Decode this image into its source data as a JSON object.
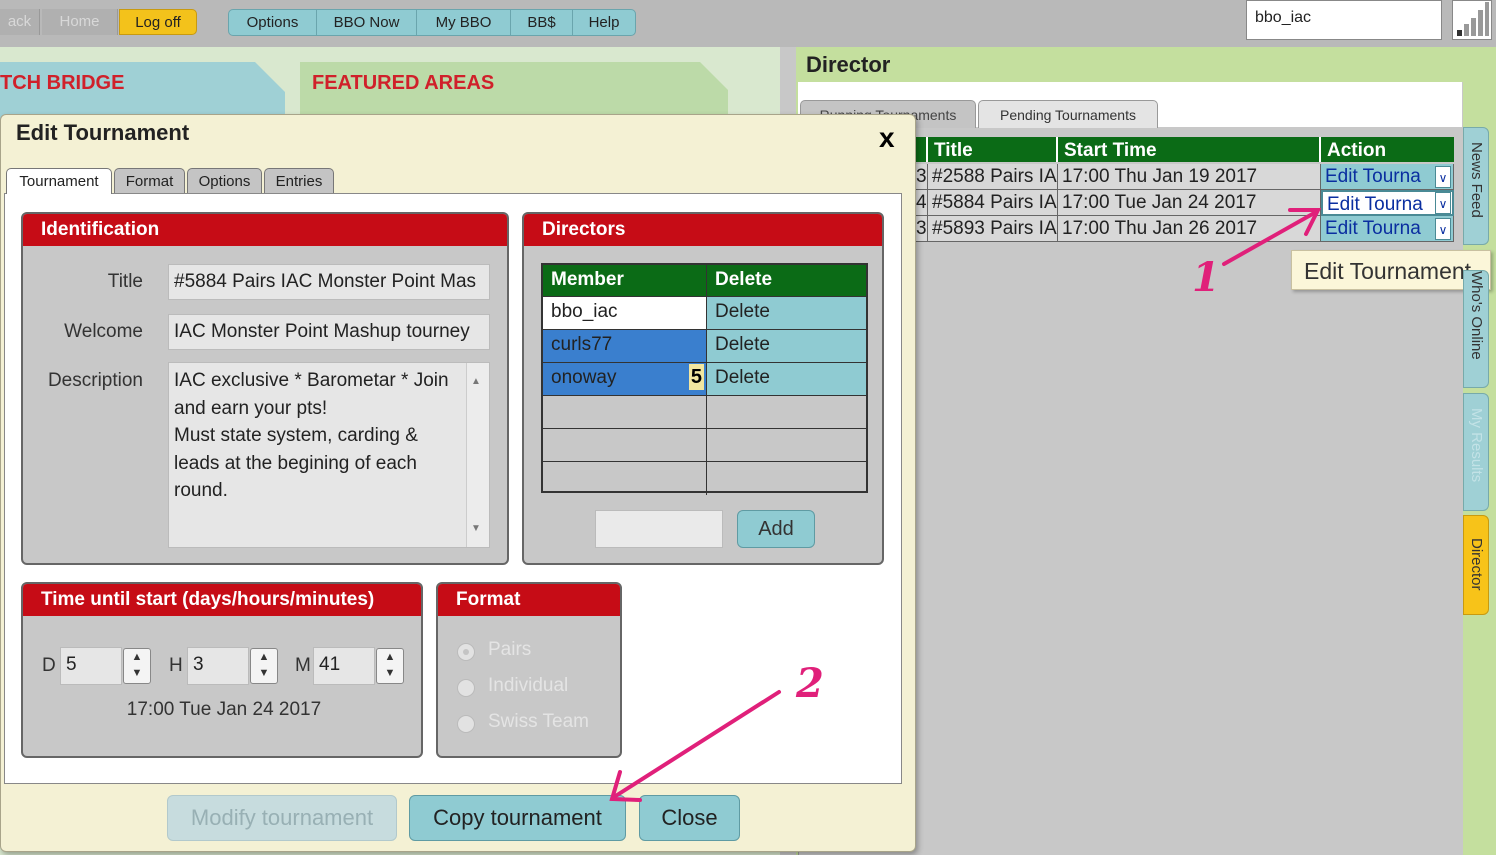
{
  "topbar": {
    "back": "ack",
    "home": "Home",
    "logoff": "Log off",
    "menu": [
      "Options",
      "BBO Now",
      "My BBO",
      "BB$",
      "Help"
    ],
    "username": "bbo_iac"
  },
  "background": {
    "left_heading": "TCH BRIDGE",
    "featured_heading": "FEATURED AREAS"
  },
  "director": {
    "title": "Director",
    "tabs": [
      "Running Tournaments",
      "Pending Tournaments"
    ],
    "columns": [
      "Title",
      "Start Time",
      "Action"
    ],
    "rows": [
      {
        "num": "3",
        "title": "#2588 Pairs IA",
        "start": "17:00 Thu Jan 19 2017",
        "action": "Edit Tourna"
      },
      {
        "num": "4",
        "title": "#5884 Pairs IA",
        "start": "17:00 Tue Jan 24 2017",
        "action": "Edit Tourna"
      },
      {
        "num": "3",
        "title": "#5893 Pairs IA",
        "start": "17:00 Thu Jan 26 2017",
        "action": "Edit Tourna"
      }
    ],
    "tooltip": "Edit Tournament",
    "side_tabs": [
      "News Feed",
      "Who's Online",
      "My Results",
      "Director"
    ]
  },
  "dialog": {
    "title": "Edit Tournament",
    "close": "x",
    "tabs": [
      "Tournament",
      "Format",
      "Options",
      "Entries"
    ],
    "identification": {
      "header": "Identification",
      "title_label": "Title",
      "title_value": "#5884 Pairs IAC Monster Point Mas",
      "welcome_label": "Welcome",
      "welcome_value": "IAC Monster Point Mashup tourney",
      "description_label": "Description",
      "description_lines": [
        "IAC exclusive * Barometar * Join",
        "and earn your pts!",
        "Must state system, carding &",
        "leads at the begining of each",
        "round."
      ]
    },
    "directors": {
      "header": "Directors",
      "col_member": "Member",
      "col_delete": "Delete",
      "members": [
        {
          "name": "bbo_iac",
          "action": "Delete"
        },
        {
          "name": "curls77",
          "action": "Delete"
        },
        {
          "name": "onoway",
          "action": "Delete",
          "badge": "5"
        }
      ],
      "add_button": "Add"
    },
    "time": {
      "header": "Time until start (days/hours/minutes)",
      "d_label": "D",
      "d_value": "5",
      "h_label": "H",
      "h_value": "3",
      "m_label": "M",
      "m_value": "41",
      "start_text": "17:00 Tue Jan 24 2017"
    },
    "format": {
      "header": "Format",
      "options": [
        "Pairs",
        "Individual",
        "Swiss Team"
      ],
      "selected": "Pairs"
    },
    "buttons": {
      "modify": "Modify tournament",
      "copy": "Copy tournament",
      "close": "Close"
    }
  },
  "annotations": {
    "label1": "1",
    "label2": "2",
    "color": "#e0207a"
  }
}
